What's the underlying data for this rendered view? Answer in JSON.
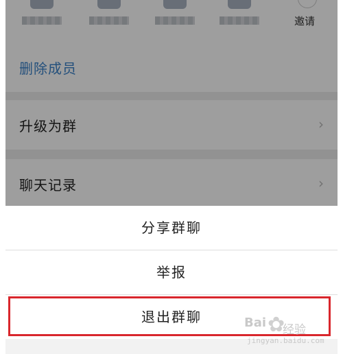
{
  "background_page": {
    "members_count_visible": 4,
    "invite_label": "邀请",
    "rows": [
      {
        "label": "删除成员",
        "accent": true,
        "has_chevron": false
      },
      {
        "label": "升级为群",
        "accent": false,
        "has_chevron": true
      },
      {
        "label": "聊天记录",
        "accent": false,
        "has_chevron": true
      }
    ],
    "chevron_glyph": "›"
  },
  "action_sheet": {
    "items": [
      {
        "label": "分享群聊"
      },
      {
        "label": "举报"
      },
      {
        "label": "退出群聊",
        "highlighted": true
      }
    ],
    "highlight_color": "#d9262c"
  },
  "watermark": {
    "brand": "Bai",
    "product": "经验",
    "url": "jingyan.baidu.com"
  },
  "colors": {
    "accent_text": "#3a82c9",
    "overlay": "rgba(0,0,0,0.38)"
  }
}
